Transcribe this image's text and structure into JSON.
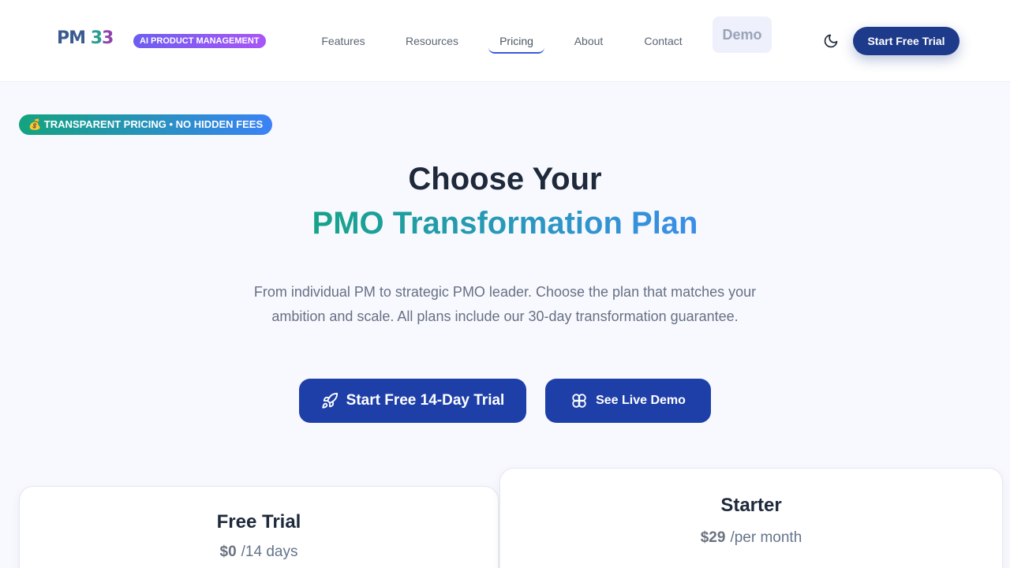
{
  "header": {
    "logo": {
      "part1": "PM",
      "part2": " 3",
      "part3": "3"
    },
    "badge": "AI PRODUCT MANAGEMENT",
    "nav": [
      {
        "label": "Features"
      },
      {
        "label": "Resources"
      },
      {
        "label": "Pricing",
        "active": true
      },
      {
        "label": "About"
      },
      {
        "label": "Contact"
      }
    ],
    "demo_label": "Demo",
    "theme_icon": "moon-icon",
    "cta_label": "Start Free Trial"
  },
  "hero": {
    "badge": "💰 TRANSPARENT PRICING • NO HIDDEN FEES",
    "title_line1": "Choose Your",
    "title_line2": "PMO Transformation Plan",
    "subtitle": "From individual PM to strategic PMO leader. Choose the plan that matches your ambition and scale. All plans include our 30-day transformation guarantee.",
    "primary_cta": {
      "label": "Start Free 14-Day Trial",
      "icon": "rocket-icon"
    },
    "secondary_cta": {
      "label": "See Live Demo",
      "icon": "brain-icon"
    }
  },
  "plans": [
    {
      "name": "Free Trial",
      "price": "$0",
      "period": "/14 days"
    },
    {
      "name": "Starter",
      "price": "$29",
      "period": "/per month"
    }
  ],
  "colors": {
    "primary": "#1e3fa8",
    "gradient_start": "#16a38a",
    "gradient_end": "#3b8ee8",
    "badge_purple": "#7c5cf5"
  }
}
